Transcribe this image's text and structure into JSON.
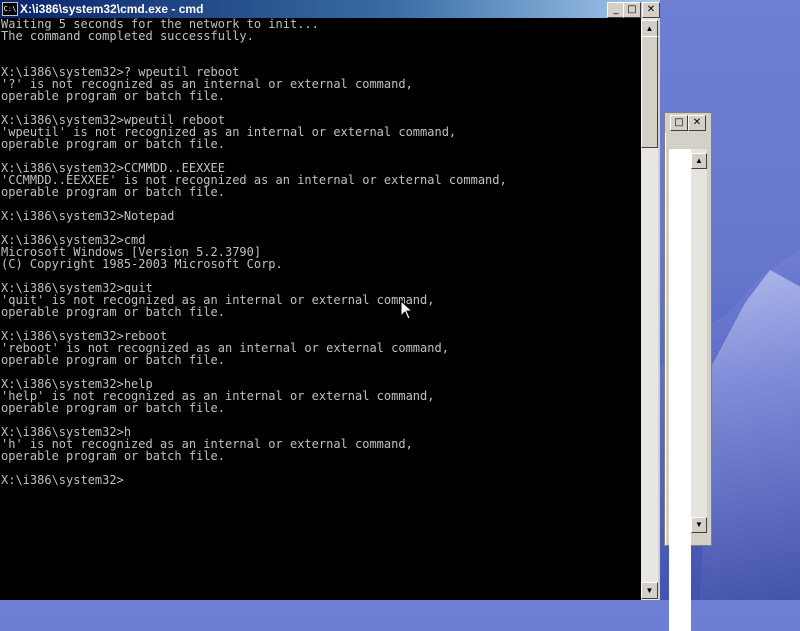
{
  "window": {
    "title": "X:\\i386\\system32\\cmd.exe - cmd",
    "icon_text": "C:\\",
    "minimize": "_",
    "maximize": "□",
    "close": "✕"
  },
  "background_window": {
    "maximize": "□",
    "close": "✕"
  },
  "scrollbar": {
    "up": "▲",
    "down": "▼"
  },
  "console_text": "Waiting 5 seconds for the network to init...\nThe command completed successfully.\n\n\nX:\\i386\\system32>? wpeutil reboot\n'?' is not recognized as an internal or external command,\noperable program or batch file.\n\nX:\\i386\\system32>wpeutil reboot\n'wpeutil' is not recognized as an internal or external command,\noperable program or batch file.\n\nX:\\i386\\system32>CCMMDD..EEXXEE\n'CCMMDD..EEXXEE' is not recognized as an internal or external command,\noperable program or batch file.\n\nX:\\i386\\system32>Notepad\n\nX:\\i386\\system32>cmd\nMicrosoft Windows [Version 5.2.3790]\n(C) Copyright 1985-2003 Microsoft Corp.\n\nX:\\i386\\system32>quit\n'quit' is not recognized as an internal or external command,\noperable program or batch file.\n\nX:\\i386\\system32>reboot\n'reboot' is not recognized as an internal or external command,\noperable program or batch file.\n\nX:\\i386\\system32>help\n'help' is not recognized as an internal or external command,\noperable program or batch file.\n\nX:\\i386\\system32>h\n'h' is not recognized as an internal or external command,\noperable program or batch file.\n\nX:\\i386\\system32>",
  "colors": {
    "console_bg": "#000000",
    "console_fg": "#c0c0c0",
    "titlebar_start": "#0a246a",
    "titlebar_end": "#a6caf0",
    "desktop": "#6676cc"
  }
}
